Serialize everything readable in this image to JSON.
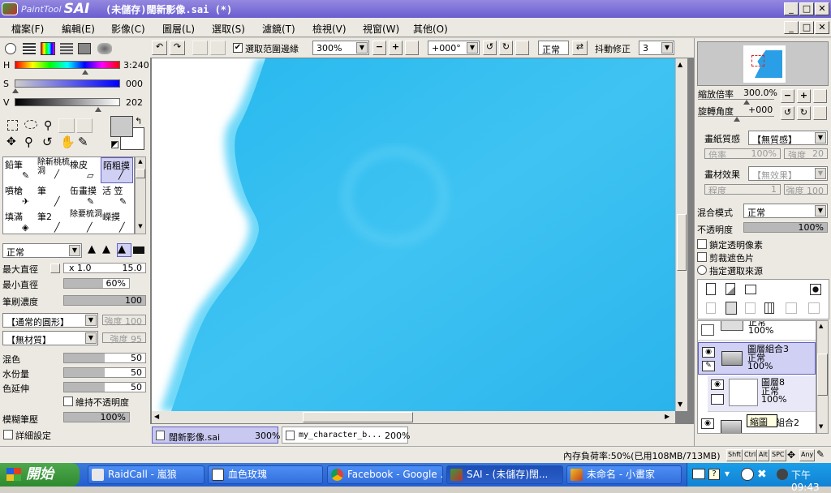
{
  "app": {
    "logo_text": "PaintTool",
    "logo_sai": "SAI",
    "window_title": "(未儲存)闊新影像.sai (*)"
  },
  "menu": [
    "檔案(F)",
    "編輯(E)",
    "影像(C)",
    "圖層(L)",
    "選取(S)",
    "濾鏡(T)",
    "檢視(V)",
    "視窗(W)",
    "其他(O)"
  ],
  "toolbar": {
    "select_edge_label": "選取范圍邊緣",
    "zoom": "300%",
    "rotation": "+000°",
    "blend": "正常",
    "stabilizer_label": "抖動修正",
    "stabilizer": "3"
  },
  "color": {
    "h_label": "H",
    "h_value": "3:240",
    "s_label": "S",
    "s_value": "000",
    "v_label": "V",
    "v_value": "202"
  },
  "tools": [
    {
      "label": "鉛筆"
    },
    {
      "label": "除斬桃梳洞"
    },
    {
      "label": "橡皮"
    },
    {
      "label": "陌粗摸"
    },
    {
      "label": "噴槍"
    },
    {
      "label": "筆"
    },
    {
      "label": "缶畫摸"
    },
    {
      "label": "活 笠"
    },
    {
      "label": "填滿"
    },
    {
      "label": "筆2"
    },
    {
      "label": "除要梳洞"
    },
    {
      "label": "嶸摸"
    }
  ],
  "brush": {
    "mode": "正常",
    "max_diam_label": "最大直徑",
    "max_mult": "x 1.0",
    "max_value": "15.0",
    "min_diam_label": "最小直徑",
    "min_value": "60%",
    "density_label": "筆刷濃度",
    "density_value": "100",
    "shape": "【通常的圓形】",
    "shape_strength": "強度 100",
    "texture": "【無材質】",
    "texture_strength": "強度 95",
    "blend_label": "混色",
    "blend_value": "50",
    "water_label": "水份量",
    "water_value": "50",
    "stretch_label": "色延伸",
    "stretch_value": "50",
    "keep_opacity_label": "維持不透明度",
    "blur_label": "模糊筆壓",
    "blur_value": "100%",
    "detail_label": "詳細設定"
  },
  "tabs": [
    {
      "name": "闊新影像.sai",
      "zoom": "300%"
    },
    {
      "name": "my_character_b...",
      "zoom": "200%"
    }
  ],
  "navigator": {
    "zoom_label": "縮放倍率",
    "zoom_value": "300.0%",
    "rot_label": "旋轉角度",
    "rot_value": "+000"
  },
  "layer_props": {
    "paper_label": "畫紙質感",
    "paper_value": "【無質感】",
    "rate_label": "倍率",
    "rate_value": "100%",
    "strength_label": "強度",
    "strength_value": "20",
    "effect_label": "畫材效果",
    "effect_value": "【無效果】",
    "degree_label": "程度",
    "degree_value": "1",
    "strength2_value": "強度 100",
    "mix_label": "混合模式",
    "mix_value": "正常",
    "opacity_label": "不透明度",
    "opacity_value": "100%",
    "lock_label": "鎖定透明像素",
    "clip_label": "剪裁遮色片",
    "select_src_label": "指定選取來源"
  },
  "layers": [
    {
      "name": "",
      "mode": "正常",
      "opacity": "100%"
    },
    {
      "name": "圖層組合3",
      "mode": "正常",
      "opacity": "100%"
    },
    {
      "name": "圖層8",
      "mode": "正常",
      "opacity": "100%"
    },
    {
      "name": "縮圖",
      "mode": "組合2",
      "opacity": ""
    }
  ],
  "status": {
    "memory": "內存負荷率:50%(已用108MB/713MB)",
    "keys": [
      "Shft",
      "Ctrl",
      "Alt",
      "SPC",
      "Any"
    ]
  },
  "taskbar": {
    "start": "開始",
    "items": [
      "RaidCall - 嵐狼",
      "血色玫瑰",
      "Facebook - Google ...",
      "SAI - (未儲存)闊...",
      "未命名 - 小畫家"
    ],
    "clock": "下午 09:43"
  }
}
